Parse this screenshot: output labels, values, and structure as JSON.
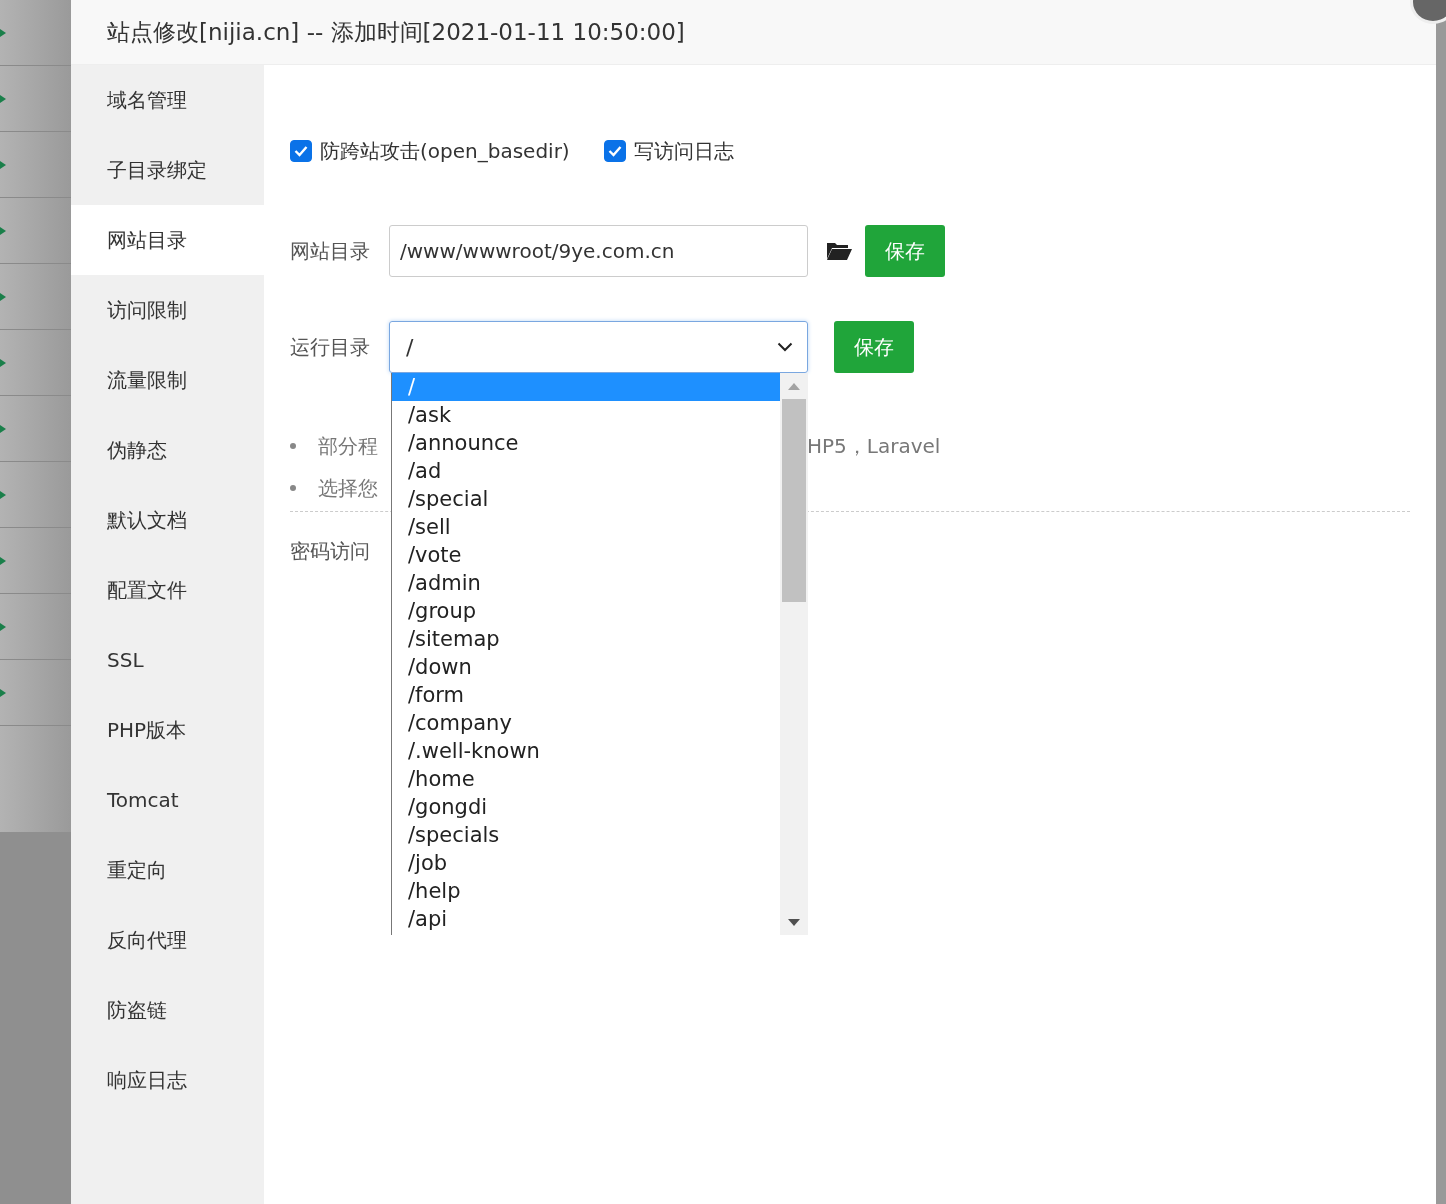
{
  "window": {
    "title": "站点修改[nijia.cn] -- 添加时间[2021-01-11 10:50:00]"
  },
  "sidebar": {
    "items": [
      {
        "label": "域名管理",
        "selected": false
      },
      {
        "label": "子目录绑定",
        "selected": false
      },
      {
        "label": "网站目录",
        "selected": true
      },
      {
        "label": "访问限制",
        "selected": false
      },
      {
        "label": "流量限制",
        "selected": false
      },
      {
        "label": "伪静态",
        "selected": false
      },
      {
        "label": "默认文档",
        "selected": false
      },
      {
        "label": "配置文件",
        "selected": false
      },
      {
        "label": "SSL",
        "selected": false
      },
      {
        "label": "PHP版本",
        "selected": false
      },
      {
        "label": "Tomcat",
        "selected": false
      },
      {
        "label": "重定向",
        "selected": false
      },
      {
        "label": "反向代理",
        "selected": false
      },
      {
        "label": "防盗链",
        "selected": false
      },
      {
        "label": "响应日志",
        "selected": false
      }
    ]
  },
  "options": [
    {
      "label": "防跨站攻击(open_basedir)",
      "checked": true
    },
    {
      "label": "写访问日志",
      "checked": true
    }
  ],
  "site_dir": {
    "label": "网站目录",
    "value": "/www/wwwroot/9ye.com.cn",
    "button": "保存"
  },
  "run_dir": {
    "label": "运行目录",
    "value": "/",
    "button": "保存",
    "items": [
      {
        "label": "/",
        "selected": true
      },
      {
        "label": "/ask",
        "selected": false
      },
      {
        "label": "/announce",
        "selected": false
      },
      {
        "label": "/ad",
        "selected": false
      },
      {
        "label": "/special",
        "selected": false
      },
      {
        "label": "/sell",
        "selected": false
      },
      {
        "label": "/vote",
        "selected": false
      },
      {
        "label": "/admin",
        "selected": false
      },
      {
        "label": "/group",
        "selected": false
      },
      {
        "label": "/sitemap",
        "selected": false
      },
      {
        "label": "/down",
        "selected": false
      },
      {
        "label": "/form",
        "selected": false
      },
      {
        "label": "/company",
        "selected": false
      },
      {
        "label": "/.well-known",
        "selected": false
      },
      {
        "label": "/home",
        "selected": false
      },
      {
        "label": "/gongdi",
        "selected": false
      },
      {
        "label": "/specials",
        "selected": false
      },
      {
        "label": "/job",
        "selected": false
      },
      {
        "label": "/help",
        "selected": false
      },
      {
        "label": "/api",
        "selected": false
      }
    ]
  },
  "notes": [
    {
      "left": "部分程",
      "right": "HP5，Laravel"
    },
    {
      "left": "选择您"
    }
  ],
  "password_access": {
    "label": "密码访问"
  }
}
